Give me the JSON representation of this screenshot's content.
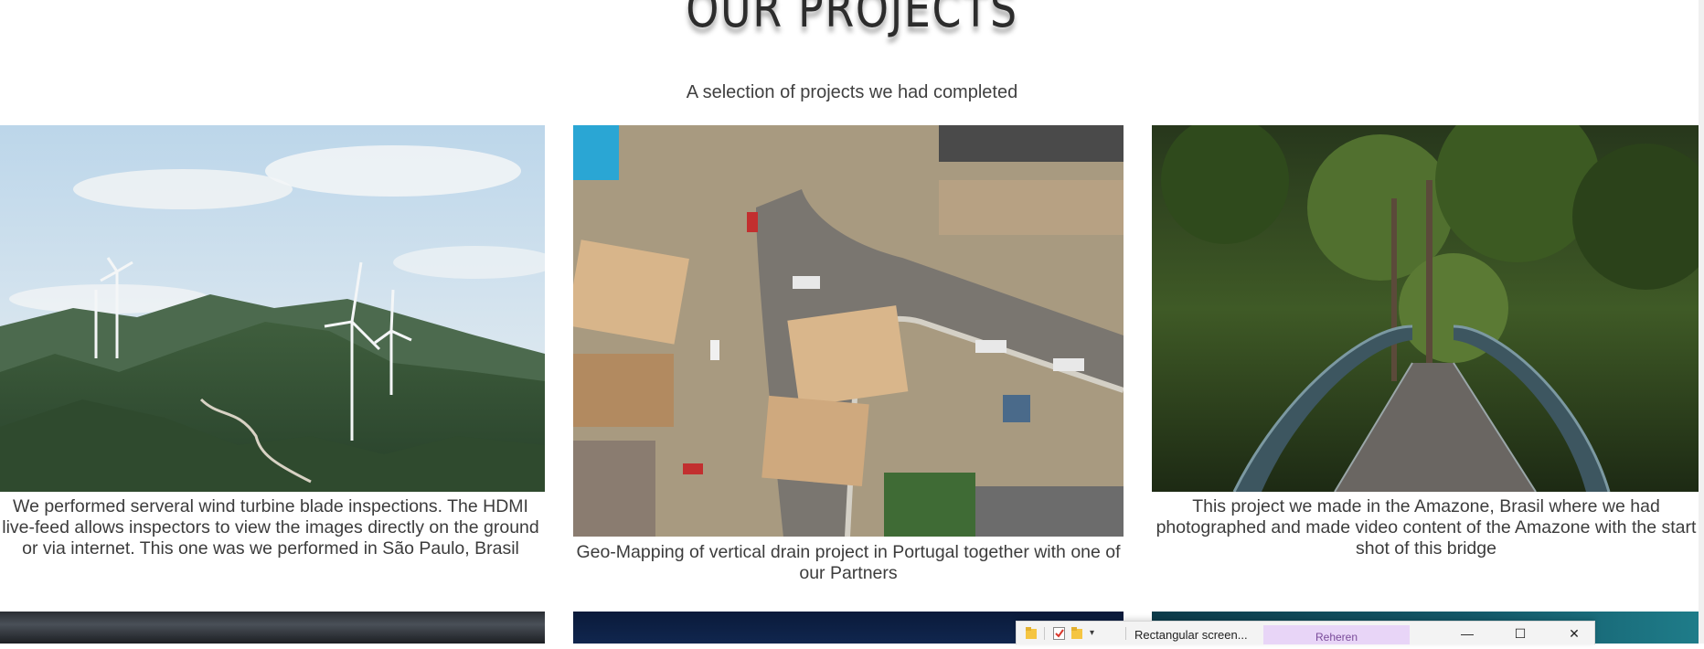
{
  "section": {
    "title": "OUR PROJECTS",
    "subtitle": "A selection of projects we had completed"
  },
  "projects": [
    {
      "image_name": "wind-turbines-photo",
      "caption": "We performed serveral wind turbine blade inspections. The HDMI live-feed allows inspectors to view the images directly on the ground or via internet. This one was we performed in São Paulo, Brasil"
    },
    {
      "image_name": "aerial-construction-photo",
      "caption": "Geo-Mapping of vertical drain project in Portugal together with one of our Partners"
    },
    {
      "image_name": "jungle-bridge-photo",
      "caption": "This project we made in the Amazone, Brasil where we had photographed and made video content of the Amazone with the start shot of this bridge"
    }
  ],
  "taskbar_window": {
    "label": "Rectangular screen...",
    "active_item": "Reheren",
    "minimize_glyph": "—",
    "maximize_glyph": "☐",
    "close_glyph": "✕",
    "icons": [
      "folder-icon",
      "checklist-icon",
      "folder-icon",
      "dropdown-arrow-icon"
    ]
  },
  "colors": {
    "background": "#ffffff",
    "text": "#3a3a3a",
    "highlight": "#e8d5f7"
  }
}
